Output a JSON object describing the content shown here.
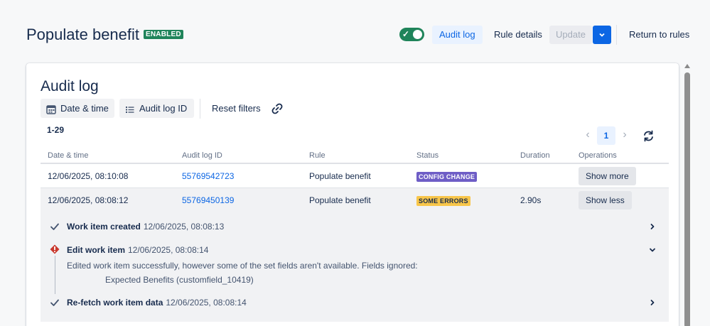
{
  "header": {
    "title": "Populate benefit",
    "status_badge": "ENABLED",
    "toggle_on": true,
    "audit_log_label": "Audit log",
    "rule_details_label": "Rule details",
    "update_label": "Update",
    "return_label": "Return to rules"
  },
  "audit": {
    "title": "Audit log",
    "filters": {
      "date_label": "Date & time",
      "id_label": "Audit log ID",
      "reset_label": "Reset filters"
    },
    "range": "1-29",
    "pagination": {
      "current_page": "1"
    },
    "columns": [
      "Date & time",
      "Audit log ID",
      "Rule",
      "Status",
      "Duration",
      "Operations"
    ],
    "rows": [
      {
        "date": "12/06/2025, 08:10:08",
        "id": "55769542723",
        "rule": "Populate benefit",
        "status": "CONFIG CHANGE",
        "duration": "",
        "operation": "Show more"
      },
      {
        "date": "12/06/2025, 08:08:12",
        "id": "55769450139",
        "rule": "Populate benefit",
        "status": "SOME ERRORS",
        "duration": "2.90s",
        "operation": "Show less"
      }
    ],
    "steps": [
      {
        "title": "Work item created",
        "time": "12/06/2025, 08:08:13"
      },
      {
        "title": "Edit work item",
        "time": "12/06/2025, 08:08:14",
        "message": "Edited work item successfully, however some of the set fields aren't available. Fields ignored:",
        "field": "Expected Benefits (customfield_10419)"
      },
      {
        "title": "Re-fetch work item data",
        "time": "12/06/2025, 08:08:14"
      }
    ]
  },
  "colors": {
    "brand_green": "#1f845a",
    "primary_blue": "#0c66e4",
    "config_change": "#6e5dc6",
    "some_errors": "#f8c64a",
    "error_red": "#c9372c"
  },
  "icons": {
    "toggle": "check-icon",
    "dropdown": "chevron-down-icon",
    "date_filter": "calendar-icon",
    "id_filter": "list-icon",
    "link": "link-icon",
    "prev": "chevron-left-icon",
    "next": "chevron-right-icon",
    "refresh": "refresh-icon",
    "success": "check-icon",
    "error": "error-icon"
  }
}
